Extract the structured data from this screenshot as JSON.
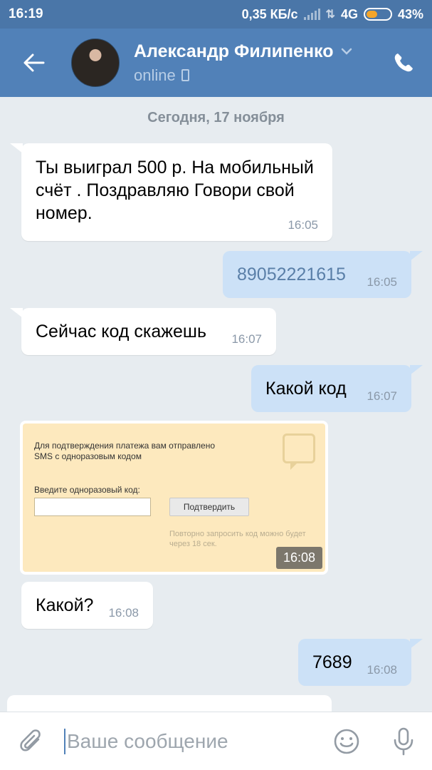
{
  "status_bar": {
    "time": "16:19",
    "speed": "0,35 КБ/с",
    "network": "4G",
    "battery": "43%",
    "battery_level": 0.43,
    "battery_color": "#f4a52a"
  },
  "header": {
    "contact_name": "Александр Филипенко",
    "status": "online",
    "back_icon": "arrow-left-icon",
    "call_icon": "phone-icon",
    "bg_color": "#5181b8"
  },
  "date_divider": "Сегодня, 17 ноября",
  "messages": [
    {
      "direction": "in",
      "text": "Ты выиграл 500 р. На мобильный счёт . Поздравляю Говори свой номер.",
      "time": "16:05"
    },
    {
      "direction": "out",
      "text": "89052221615",
      "time": "16:05"
    },
    {
      "direction": "in",
      "text": "Сейчас код скажешь",
      "time": "16:07"
    },
    {
      "direction": "out",
      "text": "Какой код",
      "time": "16:07"
    },
    {
      "direction": "in",
      "type": "photo",
      "time": "16:08",
      "photo": {
        "text1": "Для подтверждения платежа вам отправлено SMS с одноразовым кодом",
        "label": "Введите одноразовый код:",
        "button": "Подтвердить",
        "note": "Повторно запросить код можно будет через 18 сек."
      }
    },
    {
      "direction": "in",
      "text": "Какой?",
      "time": "16:08"
    },
    {
      "direction": "out",
      "text": "7689",
      "time": "16:08"
    }
  ],
  "composer": {
    "placeholder": "Ваше сообщение",
    "attach_icon": "paperclip-icon",
    "emoji_icon": "smiley-icon",
    "mic_icon": "microphone-icon"
  }
}
